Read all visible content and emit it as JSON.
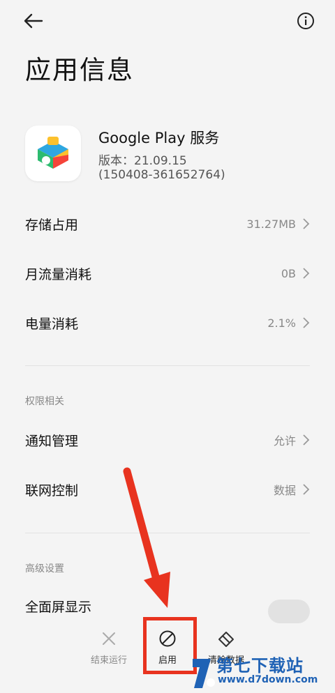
{
  "header": {
    "back_icon": "arrow-left-icon",
    "info_icon": "info-icon",
    "title": "应用信息"
  },
  "app": {
    "name": "Google Play 服务",
    "version": "版本：21.09.15",
    "build": "(150408-361652764)",
    "icon": "google-play-services-icon"
  },
  "rows": [
    {
      "label": "存储占用",
      "value": "31.27MB"
    },
    {
      "label": "月流量消耗",
      "value": "0B"
    },
    {
      "label": "电量消耗",
      "value": "2.1%"
    }
  ],
  "permissions": {
    "header": "权限相关",
    "items": [
      {
        "label": "通知管理",
        "value": "允许"
      },
      {
        "label": "联网控制",
        "value": "数据"
      }
    ]
  },
  "advanced": {
    "header": "高级设置",
    "fullscreen_label": "全面屏显示"
  },
  "bottom_bar": {
    "force_stop": "结束运行",
    "enable": "启用",
    "clear_data": "清除数据"
  },
  "watermark": {
    "title": "第七下载站",
    "url": "www.d7down.com"
  },
  "colors": {
    "accent_red": "#e8331f",
    "watermark_blue": "#1f62b5"
  }
}
